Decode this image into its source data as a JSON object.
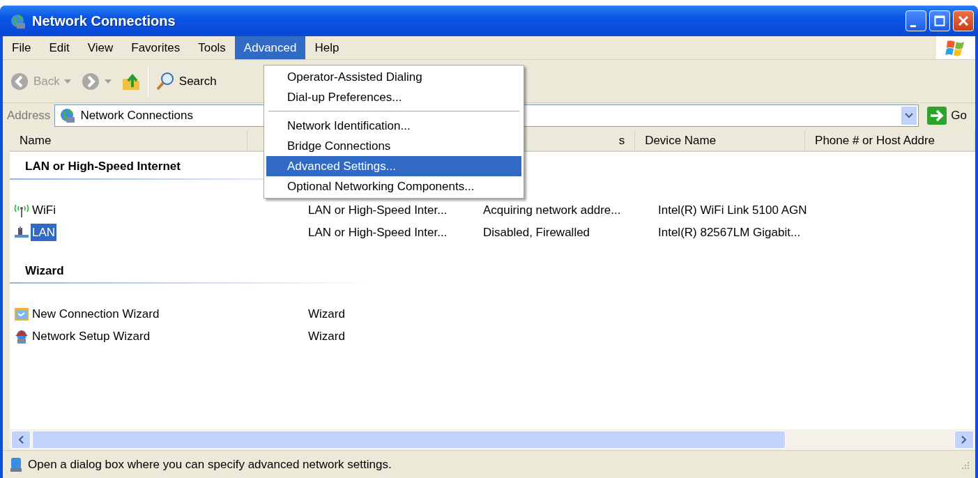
{
  "window": {
    "title": "Network Connections"
  },
  "menu_bar": [
    {
      "label": "File",
      "selected": false
    },
    {
      "label": "Edit",
      "selected": false
    },
    {
      "label": "View",
      "selected": false
    },
    {
      "label": "Favorites",
      "selected": false
    },
    {
      "label": "Tools",
      "selected": false
    },
    {
      "label": "Advanced",
      "selected": true
    },
    {
      "label": "Help",
      "selected": false
    }
  ],
  "menu": {
    "items": [
      {
        "kind": "item",
        "label": "Operator-Assisted Dialing",
        "selected": false
      },
      {
        "kind": "item",
        "label": "Dial-up Preferences...",
        "selected": false
      },
      {
        "kind": "separator"
      },
      {
        "kind": "item",
        "label": "Network Identification...",
        "selected": false
      },
      {
        "kind": "item",
        "label": "Bridge Connections",
        "selected": false
      },
      {
        "kind": "item",
        "label": "Advanced Settings...",
        "selected": true
      },
      {
        "kind": "item",
        "label": "Optional Networking Components...",
        "selected": false
      }
    ]
  },
  "toolbar": [
    {
      "kind": "back",
      "label": "Back",
      "disabled": true
    },
    {
      "kind": "forward",
      "disabled": true
    },
    {
      "kind": "up"
    },
    {
      "kind": "separator"
    },
    {
      "kind": "search",
      "label": "Search"
    }
  ],
  "address": {
    "label": "Address",
    "value": "Network Connections",
    "go": "Go"
  },
  "columns": [
    {
      "label": "Name"
    },
    {
      "label": "s"
    },
    {
      "label": "Device Name"
    },
    {
      "label": "Phone # or Host Addre"
    }
  ],
  "groups": [
    {
      "title": "LAN or High-Speed Internet",
      "items": [
        {
          "kind": "wifi",
          "name": "WiFi",
          "type": "LAN or High-Speed Inter...",
          "status": "Acquiring network addre...",
          "device": "Intel(R) WiFi Link 5100 AGN",
          "selected": false
        },
        {
          "kind": "lan",
          "name": "LAN",
          "type": "LAN or High-Speed Inter...",
          "status": "Disabled, Firewalled",
          "device": "Intel(R) 82567LM Gigabit...",
          "selected": true
        }
      ]
    },
    {
      "title": "Wizard",
      "items": [
        {
          "kind": "new-wizard",
          "name": "New Connection Wizard",
          "type": "Wizard",
          "selected": false
        },
        {
          "kind": "setup-wizard",
          "name": "Network Setup Wizard",
          "type": "Wizard",
          "selected": false
        }
      ]
    }
  ],
  "status_bar": {
    "text": "Open a dialog box where you can specify advanced network settings."
  }
}
